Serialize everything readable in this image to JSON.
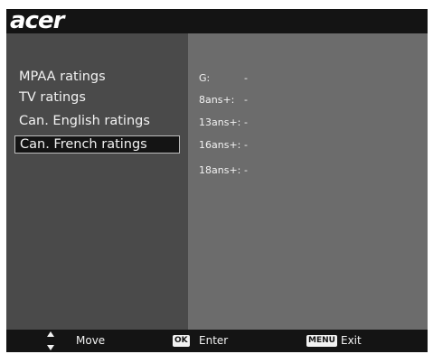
{
  "header": {
    "logo_text": "acer"
  },
  "menu": {
    "items": [
      {
        "label": "MPAA ratings"
      },
      {
        "label": "TV ratings"
      },
      {
        "label": "Can. English ratings"
      },
      {
        "label": "Can. French ratings",
        "selected": true
      }
    ]
  },
  "ratings": [
    {
      "label": "G:",
      "value": "-"
    },
    {
      "label": "8ans+:",
      "value": "-"
    },
    {
      "label": "13ans+:",
      "value": "-"
    },
    {
      "label": "16ans+:",
      "value": "-"
    },
    {
      "label": "18ans+:",
      "value": "-"
    }
  ],
  "footer": {
    "move_label": "Move",
    "ok_badge": "OK",
    "enter_label": "Enter",
    "menu_badge": "MENU",
    "exit_label": "Exit"
  },
  "colors": {
    "header_bg": "#141414",
    "left_panel_bg": "#4a4a4a",
    "right_panel_bg": "#6c6c6c",
    "text": "#f2f2f2"
  }
}
